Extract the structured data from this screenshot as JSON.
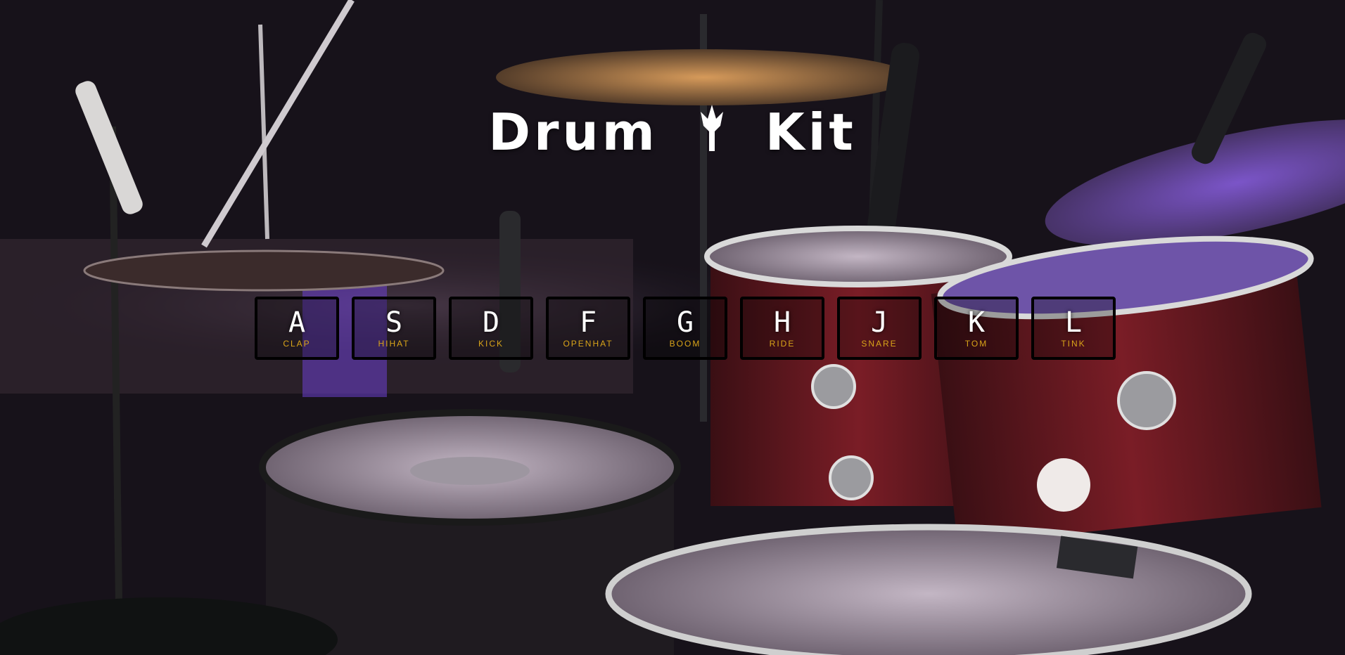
{
  "title": {
    "left": "Drum",
    "right": "Kit",
    "icon": "trident-icon"
  },
  "keys": [
    {
      "key": "A",
      "sound": "CLAP"
    },
    {
      "key": "S",
      "sound": "HIHAT"
    },
    {
      "key": "D",
      "sound": "KICK"
    },
    {
      "key": "F",
      "sound": "OPENHAT"
    },
    {
      "key": "G",
      "sound": "BOOM"
    },
    {
      "key": "H",
      "sound": "RIDE"
    },
    {
      "key": "J",
      "sound": "SNARE"
    },
    {
      "key": "K",
      "sound": "TOM"
    },
    {
      "key": "L",
      "sound": "TINK"
    }
  ],
  "colors": {
    "key_border": "#000000",
    "sound_label": "#d9a419",
    "title": "#ffffff",
    "background": "#17121a"
  }
}
